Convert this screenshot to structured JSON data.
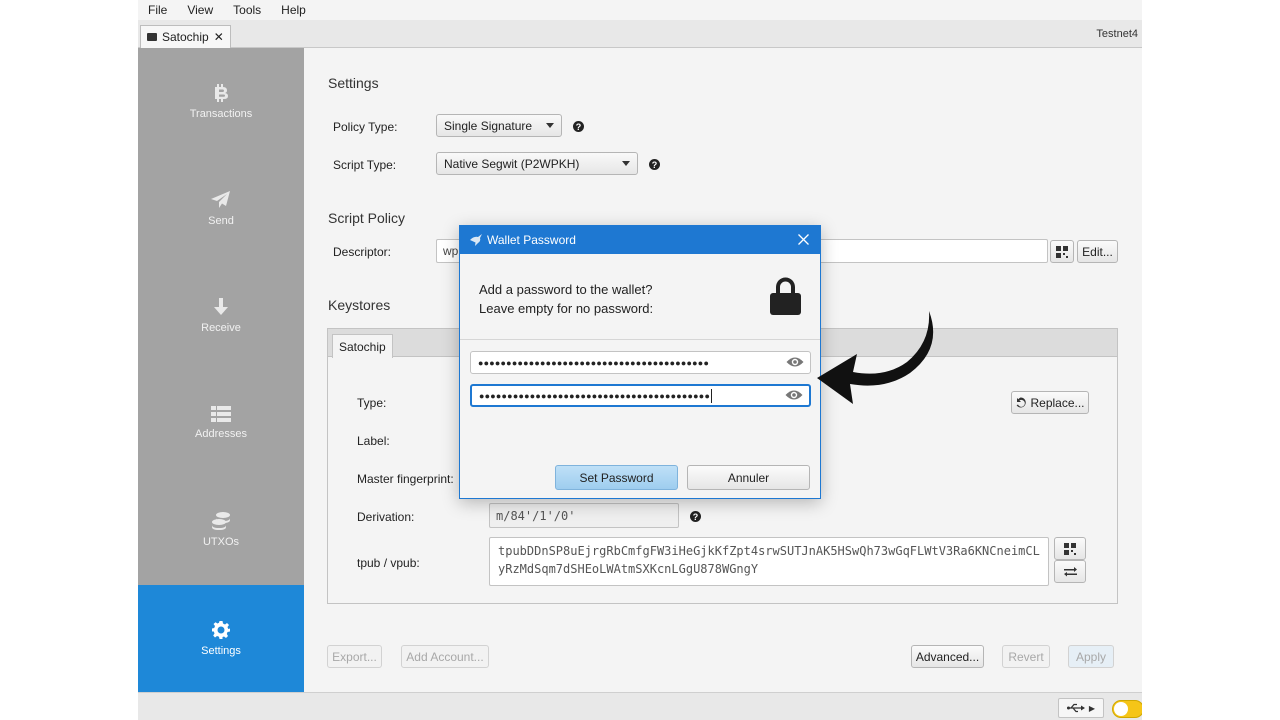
{
  "menu": [
    "File",
    "View",
    "Tools",
    "Help"
  ],
  "wallet_tab": {
    "label": "Satochip",
    "close": "✕"
  },
  "network": "Testnet4",
  "sidebar": {
    "items": [
      {
        "label": "Transactions",
        "icon": "bitcoin-icon"
      },
      {
        "label": "Send",
        "icon": "paper-plane-icon"
      },
      {
        "label": "Receive",
        "icon": "arrow-down-icon"
      },
      {
        "label": "Addresses",
        "icon": "list-icon"
      },
      {
        "label": "UTXOs",
        "icon": "coins-icon"
      },
      {
        "label": "Settings",
        "icon": "gear-icon",
        "active": true
      }
    ]
  },
  "settings": {
    "title": "Settings",
    "policy_type_label": "Policy Type:",
    "policy_type_value": "Single Signature",
    "script_type_label": "Script Type:",
    "script_type_value": "Native Segwit (P2WPKH)",
    "help_glyph": "?"
  },
  "script_policy": {
    "title": "Script Policy",
    "descriptor_label": "Descriptor:",
    "descriptor_value": "wpk",
    "edit_label": "Edit..."
  },
  "keystores": {
    "title": "Keystores",
    "tab_label": "Satochip",
    "type_label": "Type:",
    "label_label": "Label:",
    "fingerprint_label": "Master fingerprint:",
    "derivation_label": "Derivation:",
    "derivation_value": "m/84'/1'/0'",
    "tpub_label": "tpub / vpub:",
    "tpub_value": "tpubDDnSP8uEjrgRbCmfgFW3iHeGjkKfZpt4srwSUTJnAK5HSwQh73wGqFLWtV3Ra6KNCneimCLyRzMdSqm7dSHEoLWAtmSXKcnLGgU878WGngY",
    "replace_label": "Replace..."
  },
  "bottom_buttons": {
    "export": "Export...",
    "add_account": "Add Account...",
    "advanced": "Advanced...",
    "revert": "Revert",
    "apply": "Apply"
  },
  "dialog": {
    "title": "Wallet Password",
    "line1": "Add a password to the wallet?",
    "line2": "Leave empty for no password:",
    "password1": "●●●●●●●●●●●●●●●●●●●●●●●●●●●●●●●●●●●●●●●●●",
    "password2": "●●●●●●●●●●●●●●●●●●●●●●●●●●●●●●●●●●●●●●●●●",
    "set_password": "Set Password",
    "cancel": "Annuler"
  },
  "colors": {
    "accent": "#1e88d8",
    "dialog_title": "#1e78d2",
    "sidebar": "#a3a3a3",
    "toggle": "#f5c518"
  }
}
